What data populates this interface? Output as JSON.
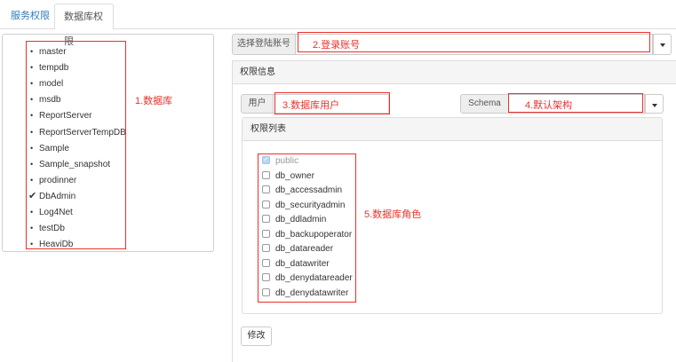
{
  "tabs": [
    {
      "label": "服务权限",
      "active": false
    },
    {
      "label": "数据库权限",
      "active": true
    }
  ],
  "databases": {
    "items": [
      {
        "name": "master",
        "checked": false
      },
      {
        "name": "tempdb",
        "checked": false
      },
      {
        "name": "model",
        "checked": false
      },
      {
        "name": "msdb",
        "checked": false
      },
      {
        "name": "ReportServer",
        "checked": false
      },
      {
        "name": "ReportServerTempDB",
        "checked": false
      },
      {
        "name": "Sample",
        "checked": false
      },
      {
        "name": "Sample_snapshot",
        "checked": false
      },
      {
        "name": "prodinner",
        "checked": false
      },
      {
        "name": "DbAdmin",
        "checked": true
      },
      {
        "name": "Log4Net",
        "checked": false
      },
      {
        "name": "testDb",
        "checked": false
      },
      {
        "name": "HeaviDb",
        "checked": false
      }
    ],
    "annotation": "1.数据库"
  },
  "login": {
    "label": "选择登陆账号",
    "annotation": "2.登录账号"
  },
  "perm_info": {
    "title": "权限信息"
  },
  "user": {
    "label": "用户",
    "annotation": "3.数据库用户"
  },
  "schema": {
    "label": "Schema",
    "annotation": "4.默认架构"
  },
  "roles": {
    "title": "权限列表",
    "annotation": "5.数据库角色",
    "items": [
      {
        "name": "public",
        "checked": true,
        "disabled": true
      },
      {
        "name": "db_owner",
        "checked": false,
        "disabled": false
      },
      {
        "name": "db_accessadmin",
        "checked": false,
        "disabled": false
      },
      {
        "name": "db_securityadmin",
        "checked": false,
        "disabled": false
      },
      {
        "name": "db_ddladmin",
        "checked": false,
        "disabled": false
      },
      {
        "name": "db_backupoperator",
        "checked": false,
        "disabled": false
      },
      {
        "name": "db_datareader",
        "checked": false,
        "disabled": false
      },
      {
        "name": "db_datawriter",
        "checked": false,
        "disabled": false
      },
      {
        "name": "db_denydatareader",
        "checked": false,
        "disabled": false
      },
      {
        "name": "db_denydatawriter",
        "checked": false,
        "disabled": false
      }
    ]
  },
  "actions": {
    "modify_label": "修改"
  },
  "colors": {
    "annotation_red": "#e8322c",
    "link_blue": "#337ab7"
  }
}
